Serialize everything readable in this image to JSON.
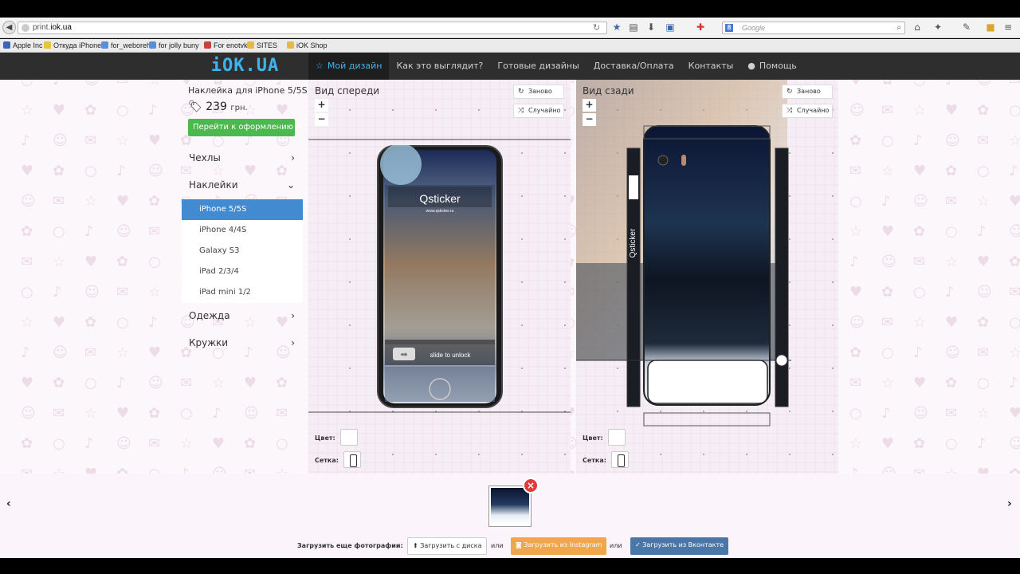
{
  "browser": {
    "url_prefix": "print.",
    "url_host": "iok.ua",
    "search_placeholder": "Google",
    "search_engine_letter": "8"
  },
  "bookmarks": [
    {
      "label": "Apple Inc",
      "color": "#3a66b5"
    },
    {
      "label": "Откуда iPhone?",
      "color": "#e7c33a"
    },
    {
      "label": "for_weboreh",
      "color": "#5a8fd8"
    },
    {
      "label": "for jolly buny",
      "color": "#5a8fd8"
    },
    {
      "label": "For enotvk",
      "color": "#c84141"
    },
    {
      "label": "SITES",
      "color": "#e3b94a"
    },
    {
      "label": "iOK Shop",
      "color": "#e3b94a"
    }
  ],
  "header": {
    "logo": "iOK.UA",
    "menu": [
      {
        "icon": "☆",
        "label": "Мой дизайн",
        "active": true
      },
      {
        "label": "Как это выглядит?"
      },
      {
        "label": "Готовые дизайны"
      },
      {
        "label": "Доставка/Оплата"
      },
      {
        "label": "Контакты"
      },
      {
        "icon": "●",
        "label": "Помощь"
      }
    ]
  },
  "sidebar": {
    "product": "Наклейка для iPhone 5/5S",
    "price": "239",
    "currency": "грн.",
    "order": "Перейти к оформлению",
    "categories": [
      {
        "label": "Чехлы",
        "chev": "›"
      },
      {
        "label": "Наклейки",
        "chev": "⌄"
      },
      {
        "label": "Одежда",
        "chev": "›"
      },
      {
        "label": "Кружки",
        "chev": "›"
      }
    ],
    "sub": [
      "iPhone 5/5S",
      "iPhone 4/4S",
      "Galaxy S3",
      "iPad 2/3/4",
      "iPad mini 1/2"
    ]
  },
  "front": {
    "title": "Вид спереди",
    "reset": "Заново",
    "random": "Случайно",
    "color_label": "Цвет:",
    "grid_label": "Сетка:",
    "screen_brand": "Qsticker",
    "screen_url": "www.qsticker.ru",
    "unlock": "slide to unlock"
  },
  "back": {
    "title": "Вид сзади",
    "reset": "Заново",
    "random": "Случайно",
    "color_label": "Цвет:",
    "grid_label": "Сетка:",
    "brand": "Qsticker"
  },
  "upload": {
    "label": "Загрузить еще фотографии:",
    "disk": "Загрузить с диска",
    "or1": "или",
    "instagram": "Загрузить из Instagram",
    "or2": "или",
    "vk": "Загрузить из Вконтакте"
  },
  "nav": {
    "prev": "‹",
    "next": "›"
  },
  "colors": {
    "accent": "#428bd1",
    "green": "#4cb84e",
    "orange": "#f0a64a",
    "vk": "#4a76a8"
  }
}
